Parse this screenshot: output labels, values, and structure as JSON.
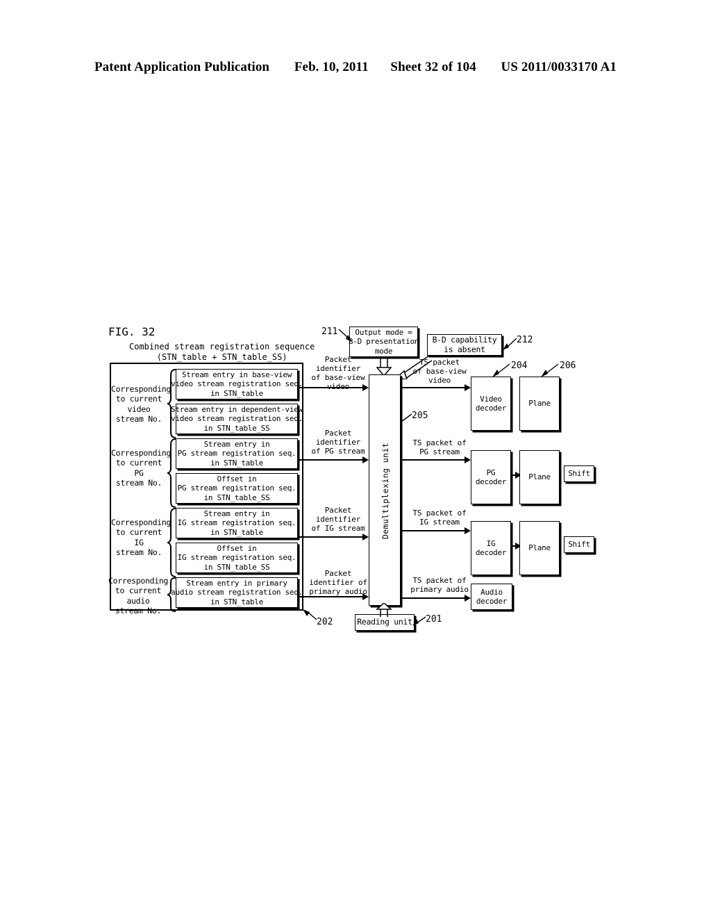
{
  "header": {
    "publication": "Patent Application Publication",
    "date": "Feb. 10, 2011",
    "sheet": "Sheet 32 of 104",
    "number": "US 2011/0033170 A1"
  },
  "figure": {
    "label": "FIG. 32",
    "title": "Combined stream registration sequence\n(STN_table + STN_table_SS)"
  },
  "group_captions": [
    {
      "text": "Corresponding\nto current\nvideo\nstream No."
    },
    {
      "text": "Corresponding\nto current\nPG\nstream No."
    },
    {
      "text": "Corresponding\nto current\nIG\nstream No."
    },
    {
      "text": "Corresponding\nto current\naudio\nstream No."
    }
  ],
  "entry_boxes": [
    {
      "text": "Stream entry in base-view\nvideo stream registration seq.\nin STN_table"
    },
    {
      "text": "Stream entry in dependent-view\nvideo stream registration seq.\nin STN_table_SS"
    },
    {
      "text": "Stream entry in\nPG stream registration seq.\nin STN_table"
    },
    {
      "text": "Offset in\nPG stream registration seq.\nin STN_table_SS"
    },
    {
      "text": "Stream entry in\nIG stream registration seq.\nin STN_table"
    },
    {
      "text": "Offset in\nIG stream registration seq.\nin STN_table_SS"
    },
    {
      "text": "Stream entry in primary\naudio stream registration seq.\nin STN_table"
    }
  ],
  "input_labels": [
    {
      "text": "Packet\nidentifier\nof base-view\nvideo"
    },
    {
      "text": "Packet\nidentifier\nof PG stream"
    },
    {
      "text": "Packet\nidentifier\nof IG stream"
    },
    {
      "text": "Packet\nidentifier of\nprimary audio"
    }
  ],
  "output_labels": [
    {
      "text": "TS packet\nof base-view\nvideo"
    },
    {
      "text": "TS packet of\nPG stream"
    },
    {
      "text": "TS packet of\nIG stream"
    },
    {
      "text": "TS packet of\nprimary audio"
    }
  ],
  "control_boxes": {
    "output_mode": "Output mode =\nB-D presentation\nmode",
    "bd_capability": "B-D capability\nis absent"
  },
  "demux": {
    "label": "Demultiplexing unit"
  },
  "decoders": [
    {
      "text": "Video\ndecoder"
    },
    {
      "text": "PG\ndecoder"
    },
    {
      "text": "IG\ndecoder"
    },
    {
      "text": "Audio\ndecoder"
    }
  ],
  "planes": [
    {
      "text": "Plane"
    },
    {
      "text": "Plane"
    },
    {
      "text": "Plane"
    }
  ],
  "shifts": [
    {
      "text": "Shift"
    },
    {
      "text": "Shift"
    }
  ],
  "reading_unit": {
    "text": "Reading unit"
  },
  "ref_numbers": {
    "r201": "201",
    "r202": "202",
    "r204": "204",
    "r205": "205",
    "r206": "206",
    "r211": "211",
    "r212": "212"
  },
  "colors": {
    "ink": "#000000",
    "paper": "#ffffff"
  }
}
